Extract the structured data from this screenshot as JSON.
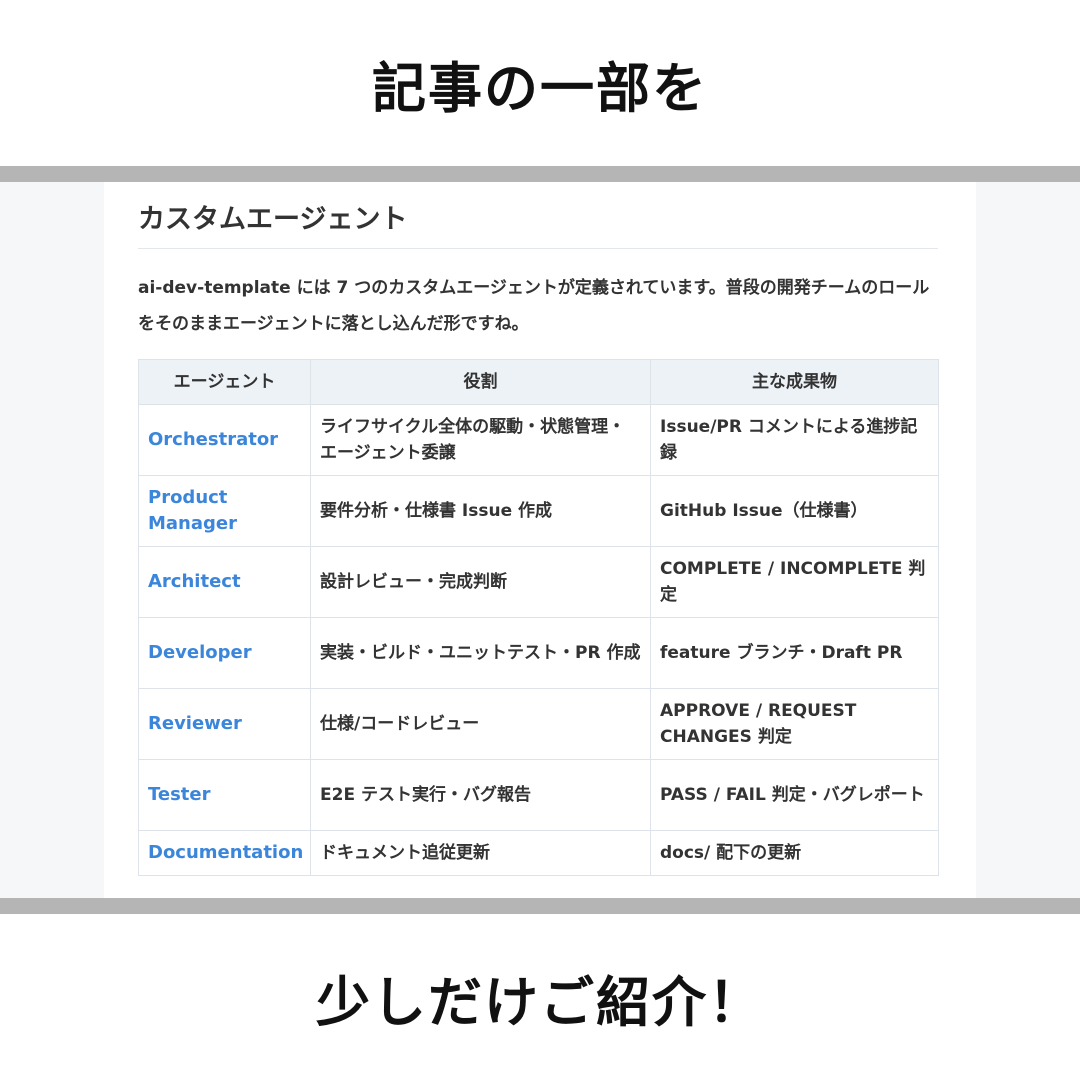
{
  "captions": {
    "top": "記事の一部を",
    "bottom": "少しだけご紹介！"
  },
  "article": {
    "heading": "カスタムエージェント",
    "intro": "ai-dev-template には 7 つのカスタムエージェントが定義されています。普段の開発チームのロールをそのままエージェントに落とし込んだ形ですね。",
    "table": {
      "headers": [
        "エージェント",
        "役割",
        "主な成果物"
      ],
      "rows": [
        {
          "agent": "Orchestrator",
          "role": "ライフサイクル全体の駆動・状態管理・エージェント委譲",
          "output": "Issue/PR コメントによる進捗記録"
        },
        {
          "agent": "Product Manager",
          "role": "要件分析・仕様書 Issue 作成",
          "output": "GitHub Issue（仕様書）"
        },
        {
          "agent": "Architect",
          "role": "設計レビュー・完成判断",
          "output": "COMPLETE / INCOMPLETE 判定"
        },
        {
          "agent": "Developer",
          "role": "実装・ビルド・ユニットテスト・PR 作成",
          "output": "feature ブランチ・Draft PR"
        },
        {
          "agent": "Reviewer",
          "role": "仕様/コードレビュー",
          "output": "APPROVE / REQUEST CHANGES 判定"
        },
        {
          "agent": "Tester",
          "role": "E2E テスト実行・バグ報告",
          "output": "PASS / FAIL 判定・バグレポート"
        },
        {
          "agent": "Documentation",
          "role": "ドキュメント追従更新",
          "output": "docs/ 配下の更新"
        }
      ]
    }
  },
  "colors": {
    "agent_link": "#3b86da",
    "header_bg": "#edf2f6",
    "band": "#b4b5b4"
  }
}
